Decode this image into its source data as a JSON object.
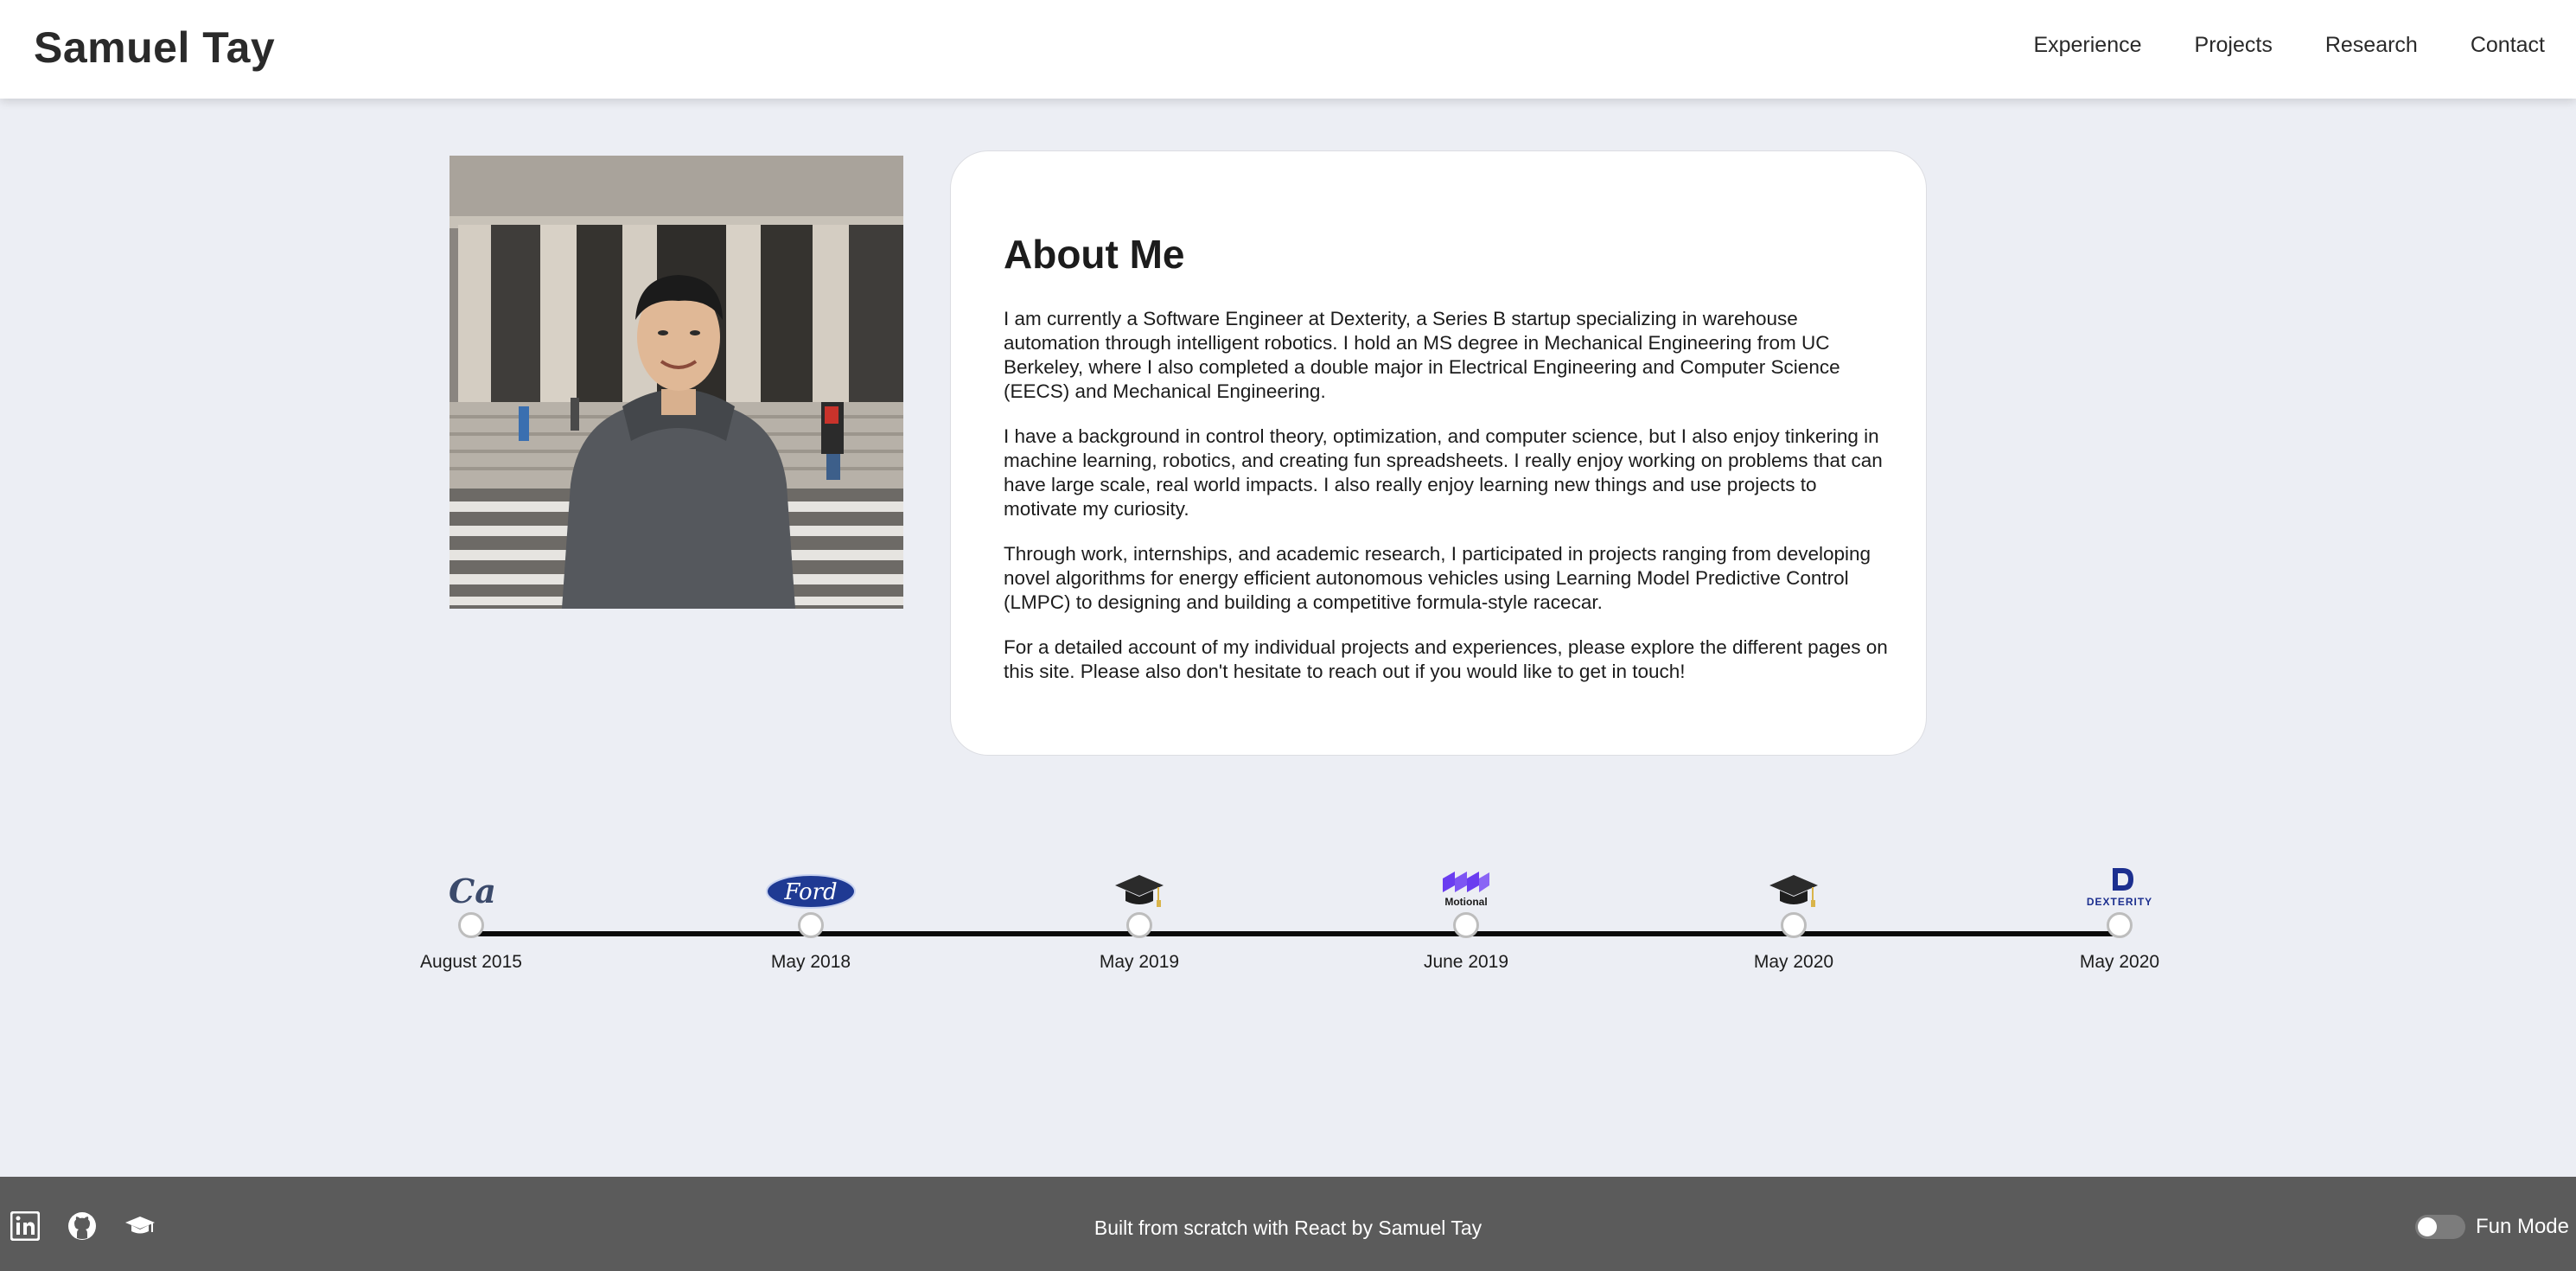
{
  "header": {
    "brand": "Samuel Tay",
    "nav": [
      "Experience",
      "Projects",
      "Research",
      "Contact"
    ]
  },
  "about": {
    "title": "About Me",
    "paragraphs": [
      "I am currently a Software Engineer at Dexterity, a Series B startup specializing in warehouse automation through intelligent robotics. I hold an MS degree in Mechanical Engineering from UC Berkeley, where I also completed a double major in Electrical Engineering and Computer Science (EECS) and Mechanical Engineering.",
      "I have a background in control theory, optimization, and computer science, but I also enjoy tinkering in machine learning, robotics, and creating fun spreadsheets. I really enjoy working on problems that can have large scale, real world impacts. I also really enjoy learning new things and use projects to motivate my curiosity.",
      "Through work, internships, and academic research, I participated in projects ranging from developing novel algorithms for energy efficient autonomous vehicles using Learning Model Predictive Control (LMPC) to designing and building a competitive formula-style racecar.",
      "For a detailed account of my individual projects and experiences, please explore the different pages on this site. Please also don't hesitate to reach out if you would like to get in touch!"
    ]
  },
  "timeline": [
    {
      "icon": "cal-logo-icon",
      "logo_text": "Cal",
      "date": "August 2015"
    },
    {
      "icon": "ford-logo-icon",
      "logo_text": "Ford",
      "date": "May 2018"
    },
    {
      "icon": "graduation-cap-icon",
      "date": "May 2019"
    },
    {
      "icon": "motional-logo-icon",
      "logo_text": "Motional",
      "date": "June 2019"
    },
    {
      "icon": "graduation-cap-icon",
      "date": "May 2020"
    },
    {
      "icon": "dexterity-logo-icon",
      "logo_text": "DEXTERITY",
      "date": "May 2020"
    }
  ],
  "footer": {
    "icons": [
      "linkedin-icon",
      "github-icon",
      "graduation-cap-icon"
    ],
    "credit": "Built from scratch with React by Samuel Tay",
    "fun_mode_label": "Fun Mode",
    "fun_mode_on": false
  },
  "colors": {
    "background": "#eceef4",
    "footer": "#5b5b5b",
    "ford_blue": "#1f3a93",
    "motional_purple": "#6a3df0",
    "dexterity_blue": "#1c2f8f",
    "cal_blue": "#3b4a6b"
  }
}
